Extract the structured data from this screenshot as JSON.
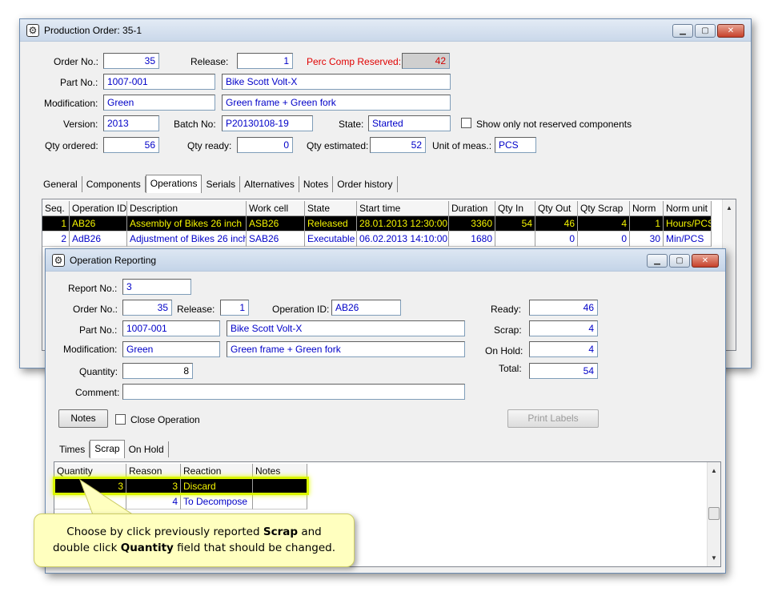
{
  "production_order": {
    "title": "Production Order: 35-1",
    "order_no_label": "Order No.:",
    "order_no": "35",
    "release_label": "Release:",
    "release": "1",
    "perc_comp_label": "Perc Comp Reserved:",
    "perc_comp": "42",
    "part_no_label": "Part No.:",
    "part_no": "1007-001",
    "part_desc": "Bike Scott Volt-X",
    "modification_label": "Modification:",
    "modification": "Green",
    "modification_desc": "Green frame + Green fork",
    "version_label": "Version:",
    "version": "2013",
    "batch_label": "Batch No:",
    "batch": "P20130108-19",
    "state_label": "State:",
    "state": "Started",
    "show_not_reserved_label": "Show only not reserved components",
    "qty_ordered_label": "Qty ordered:",
    "qty_ordered": "56",
    "qty_ready_label": "Qty ready:",
    "qty_ready": "0",
    "qty_estimated_label": "Qty estimated:",
    "qty_estimated": "52",
    "unit_label": "Unit of meas.:",
    "unit": "PCS",
    "tabs": [
      "General",
      "Components",
      "Operations",
      "Serials",
      "Alternatives",
      "Notes",
      "Order history"
    ],
    "active_tab": "Operations",
    "grid_headers": [
      "Seq.",
      "Operation ID",
      "Description",
      "Work cell",
      "State",
      "Start time",
      "Duration",
      "Qty In",
      "Qty Out",
      "Qty Scrap",
      "Norm",
      "Norm unit"
    ],
    "grid_rows": [
      [
        "1",
        "AB26",
        "Assembly of Bikes 26 inch",
        "ASB26",
        "Released",
        "28.01.2013 12:30:00",
        "3360",
        "54",
        "46",
        "4",
        "1",
        "Hours/PCS"
      ],
      [
        "2",
        "AdB26",
        "Adjustment of Bikes 26 inch",
        "SAB26",
        "Executable",
        "06.02.2013 14:10:00",
        "1680",
        "",
        "0",
        "0",
        "30",
        "Min/PCS"
      ]
    ]
  },
  "operation_reporting": {
    "title": "Operation Reporting",
    "report_no_label": "Report No.:",
    "report_no": "3",
    "order_no_label": "Order No.:",
    "order_no": "35",
    "release_label": "Release:",
    "release": "1",
    "operation_id_label": "Operation ID:",
    "operation_id": "AB26",
    "part_no_label": "Part No.:",
    "part_no": "1007-001",
    "part_desc": "Bike Scott Volt-X",
    "modification_label": "Modification:",
    "modification": "Green",
    "modification_desc": "Green frame + Green fork",
    "quantity_label": "Quantity:",
    "quantity": "8",
    "comment_label": "Comment:",
    "comment": "",
    "ready_label": "Ready:",
    "ready": "46",
    "scrap_label": "Scrap:",
    "scrap": "4",
    "on_hold_label": "On Hold:",
    "on_hold": "4",
    "total_label": "Total:",
    "total": "54",
    "notes_button": "Notes",
    "close_operation_label": "Close Operation",
    "print_labels_button": "Print Labels",
    "tabs": [
      "Times",
      "Scrap",
      "On Hold"
    ],
    "active_tab": "Scrap",
    "grid_headers": [
      "Quantity",
      "Reason",
      "Reaction",
      "Notes"
    ],
    "grid_rows": [
      [
        "3",
        "3",
        "Discard",
        ""
      ],
      [
        "",
        "4",
        "To Decompose",
        ""
      ]
    ]
  },
  "callout": {
    "line1_pre": "Choose by click previously reported ",
    "line1_bold": "Scrap",
    "line1_post": " and",
    "line2_pre": "double click ",
    "line2_bold": "Quantity",
    "line2_post": " field that should be changed."
  },
  "colors": {
    "title_gradient_top": "#e3ebf5",
    "selected_row_bg": "#000000",
    "selected_row_text": "#f4f400",
    "value_text": "#0000c8",
    "highlight": "#d9f500",
    "callout_bg": "#ffffbf",
    "label_red": "#e00000"
  }
}
